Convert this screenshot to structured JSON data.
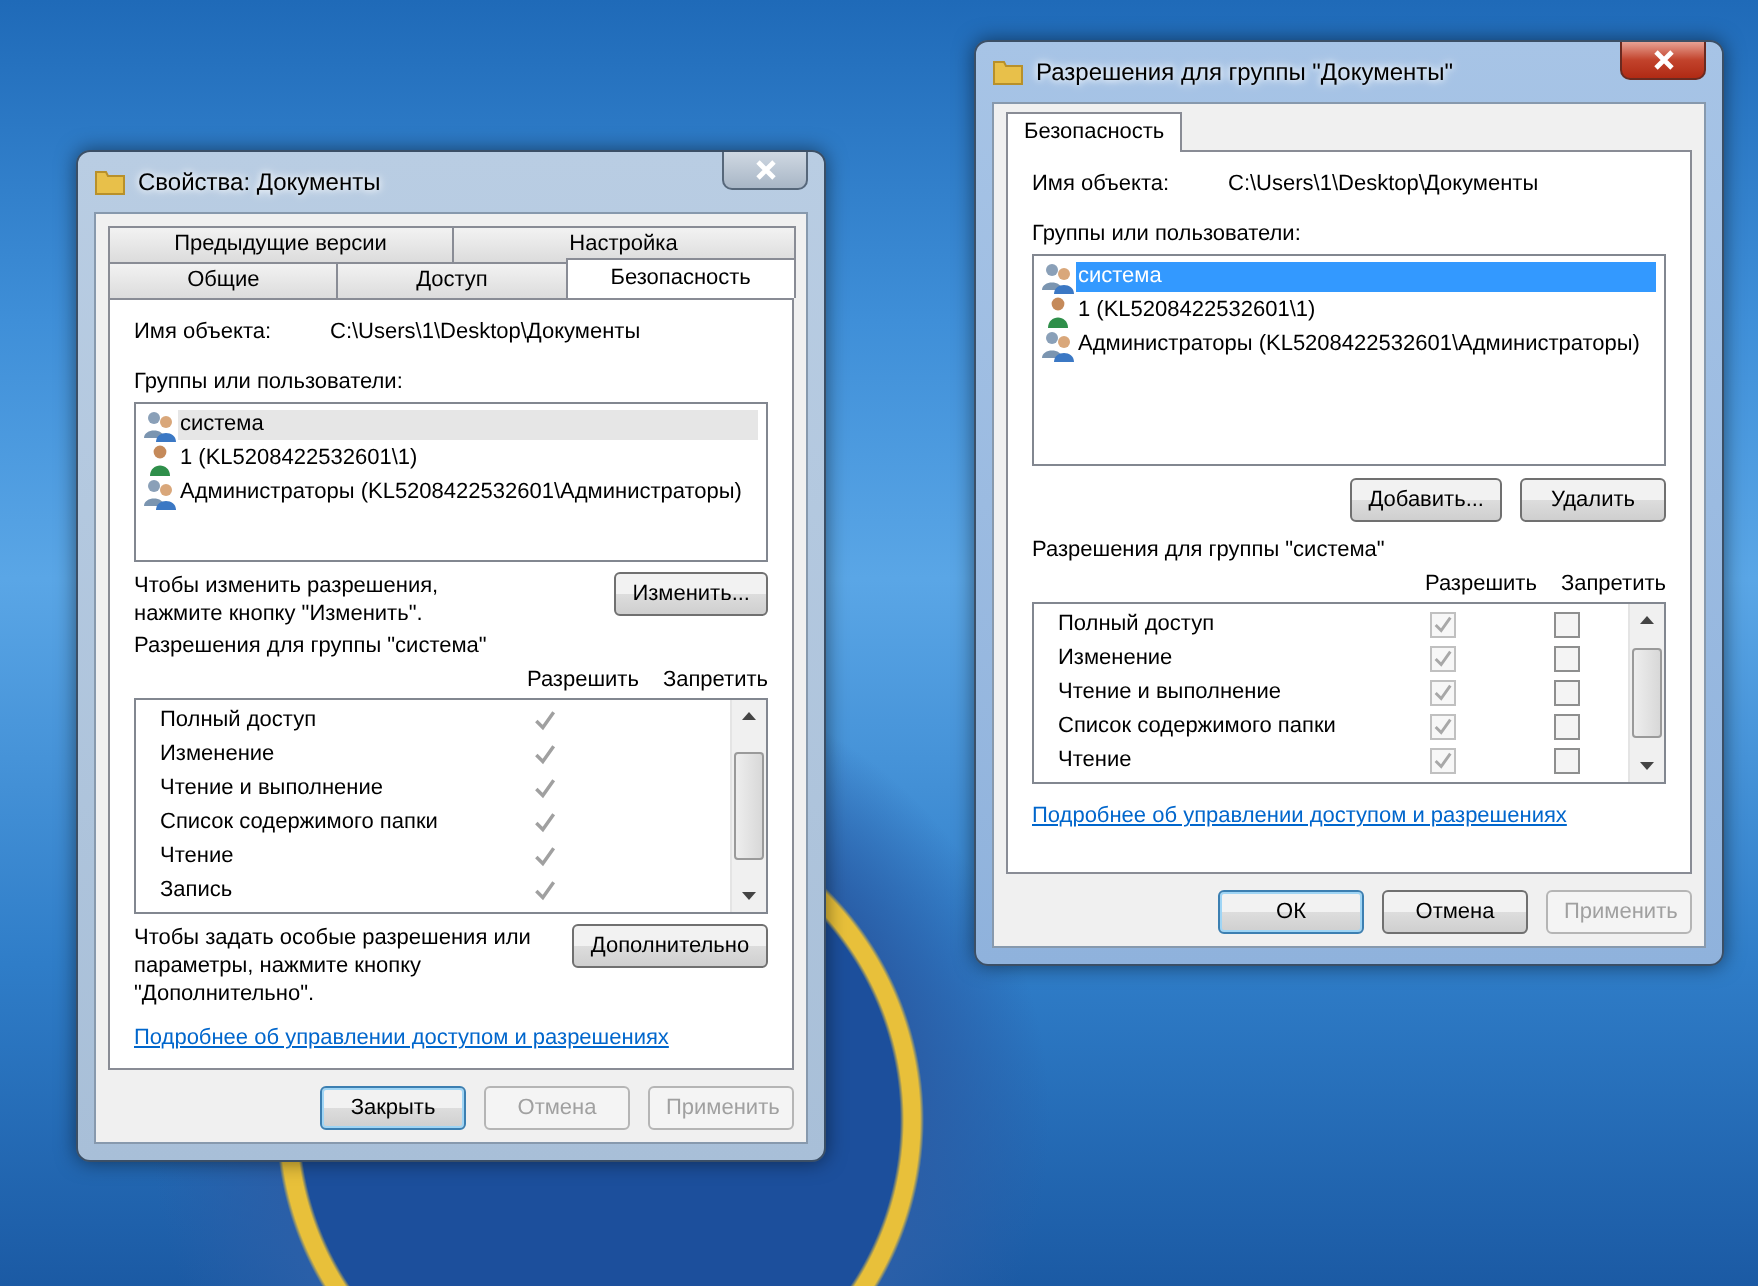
{
  "windows": [
    {
      "kind": "properties",
      "active": false,
      "title": "Свойства: Документы",
      "tab_rows": [
        [
          {
            "label": "Предыдущие версии",
            "selected": false
          },
          {
            "label": "Настройка",
            "selected": false
          }
        ],
        [
          {
            "label": "Общие",
            "selected": false
          },
          {
            "label": "Доступ",
            "selected": false
          },
          {
            "label": "Безопасность",
            "selected": true
          }
        ]
      ],
      "object_label": "Имя объекта:",
      "object_path": "C:\\Users\\1\\Desktop\\Документы",
      "groups_label": "Группы или пользователи:",
      "list_focused": false,
      "principals": [
        {
          "kind": "group",
          "name": "система",
          "selected": true
        },
        {
          "kind": "user",
          "name": "1 (KL5208422532601\\1)",
          "selected": false
        },
        {
          "kind": "group",
          "name": "Администраторы (KL5208422532601\\Администраторы)",
          "selected": false
        }
      ],
      "change_hint": "Чтобы изменить разрешения,\nнажмите кнопку \"Изменить\".",
      "change_button": "Изменить...",
      "permissions_label": "Разрешения для группы \"система\"",
      "allow_header": "Разрешить",
      "deny_header": "Запретить",
      "permissions": [
        {
          "name": "Полный доступ",
          "allow": true
        },
        {
          "name": "Изменение",
          "allow": true
        },
        {
          "name": "Чтение и выполнение",
          "allow": true
        },
        {
          "name": "Список содержимого папки",
          "allow": true
        },
        {
          "name": "Чтение",
          "allow": true
        },
        {
          "name": "Запись",
          "allow": true
        }
      ],
      "advanced_hint": "Чтобы задать особые разрешения или\nпараметры, нажмите кнопку\n\"Дополнительно\".",
      "advanced_button": "Дополнительно",
      "help_link": "Подробнее об управлении доступом и разрешениях",
      "buttons": [
        {
          "label": "Закрыть",
          "default": true,
          "disabled": false
        },
        {
          "label": "Отмена",
          "default": false,
          "disabled": true
        },
        {
          "label": "Применить",
          "default": false,
          "disabled": true
        }
      ]
    },
    {
      "kind": "permissions",
      "active": true,
      "title": "Разрешения для группы \"Документы\"",
      "tab_rows": [
        [
          {
            "label": "Безопасность",
            "selected": true
          }
        ]
      ],
      "object_label": "Имя объекта:",
      "object_path": "C:\\Users\\1\\Desktop\\Документы",
      "groups_label": "Группы или пользователи:",
      "list_focused": true,
      "principals": [
        {
          "kind": "group",
          "name": "система",
          "selected": true
        },
        {
          "kind": "user",
          "name": "1 (KL5208422532601\\1)",
          "selected": false
        },
        {
          "kind": "group",
          "name": "Администраторы (KL5208422532601\\Администраторы)",
          "selected": false
        }
      ],
      "list_buttons": [
        {
          "label": "Добавить..."
        },
        {
          "label": "Удалить"
        }
      ],
      "permissions_label": "Разрешения для группы \"система\"",
      "allow_header": "Разрешить",
      "deny_header": "Запретить",
      "permissions": [
        {
          "name": "Полный доступ",
          "allow": true,
          "allow_disabled": true,
          "deny": false
        },
        {
          "name": "Изменение",
          "allow": true,
          "allow_disabled": true,
          "deny": false
        },
        {
          "name": "Чтение и выполнение",
          "allow": true,
          "allow_disabled": true,
          "deny": false
        },
        {
          "name": "Список содержимого папки",
          "allow": true,
          "allow_disabled": true,
          "deny": false
        },
        {
          "name": "Чтение",
          "allow": true,
          "allow_disabled": true,
          "deny": false
        }
      ],
      "help_link": "Подробнее об управлении доступом и разрешениях",
      "buttons": [
        {
          "label": "ОК",
          "default": true,
          "disabled": false
        },
        {
          "label": "Отмена",
          "default": false,
          "disabled": false
        },
        {
          "label": "Применить",
          "default": false,
          "disabled": true
        }
      ]
    }
  ]
}
